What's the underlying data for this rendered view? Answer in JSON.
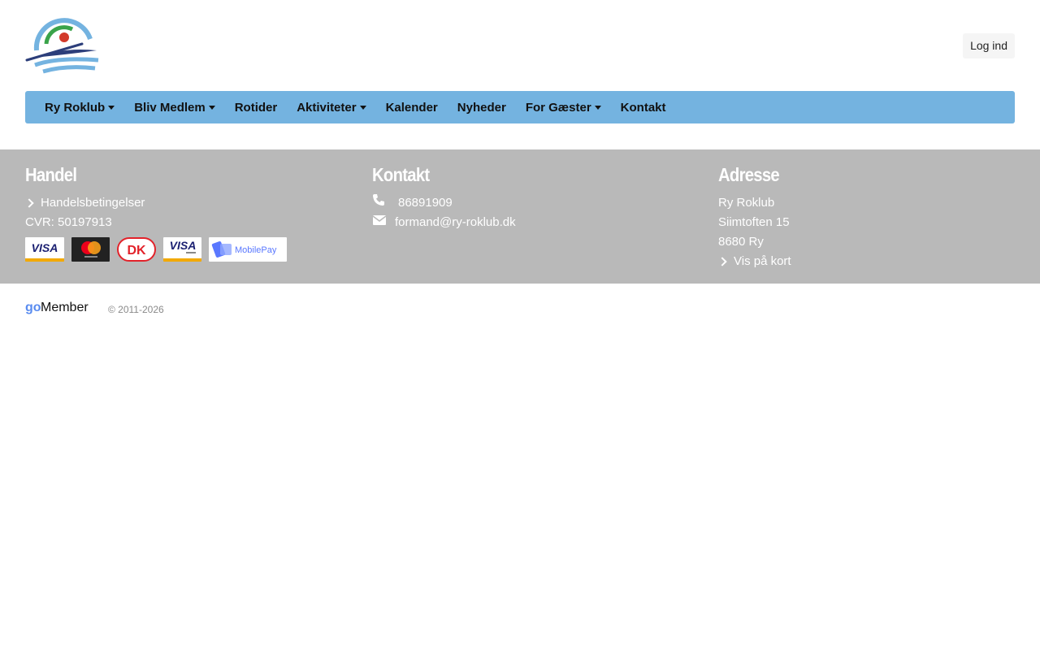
{
  "header": {
    "login_label": "Log ind"
  },
  "nav": {
    "items": [
      {
        "label": "Ry Roklub",
        "dropdown": true
      },
      {
        "label": "Bliv Medlem",
        "dropdown": true
      },
      {
        "label": "Rotider",
        "dropdown": false
      },
      {
        "label": "Aktiviteter",
        "dropdown": true
      },
      {
        "label": "Kalender",
        "dropdown": false
      },
      {
        "label": "Nyheder",
        "dropdown": false
      },
      {
        "label": "For Gæster",
        "dropdown": true
      },
      {
        "label": "Kontakt",
        "dropdown": false
      }
    ],
    "bar_color": "#74b3e0"
  },
  "footer": {
    "handel": {
      "title": "Handel",
      "terms_link": "Handelsbetingelser",
      "cvr": "CVR: 50197913",
      "payment_icons": [
        "visa-icon",
        "mastercard-icon",
        "dankort-icon",
        "visa-electron-icon",
        "mobilepay-icon"
      ]
    },
    "kontakt": {
      "title": "Kontakt",
      "phone": "86891909",
      "email": "formand@ry-roklub.dk"
    },
    "adresse": {
      "title": "Adresse",
      "name": "Ry Roklub",
      "street": "Siimtoften 15",
      "city": "8680 Ry",
      "map_link": "Vis på kort"
    },
    "background_color": "#b9b9b9"
  },
  "bottom": {
    "copyright": "© 2011-2026"
  }
}
